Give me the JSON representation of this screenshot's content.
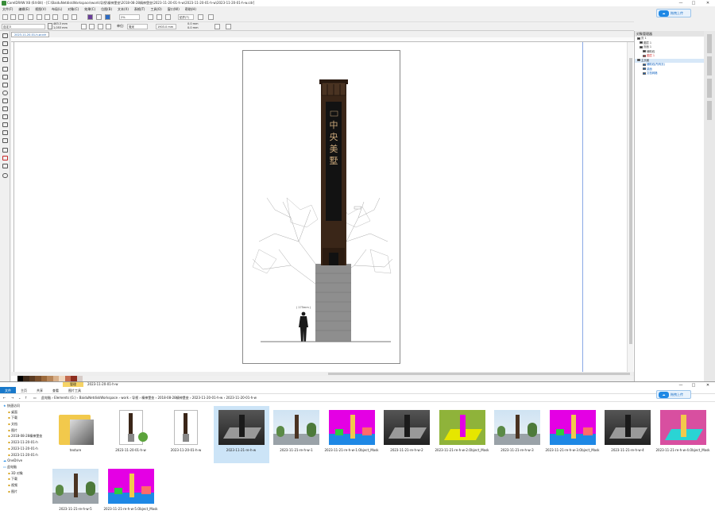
{
  "window": {
    "title": "CorelDRAW X8 (64-Bit) - [C:\\BaiduNetdiskWorkspace\\work\\导视\\精神堡垒\\2018-08-28精神堡垒\\2023-11-20-01-h-w\\2023-11-20-01-h-w\\2023-11-20-01-h-w.cdr]",
    "minimize": "—",
    "maximize": "□",
    "close": "✕"
  },
  "menu": [
    "文件(F)",
    "编辑(E)",
    "视图(V)",
    "布局(L)",
    "对象(C)",
    "效果(C)",
    "位图(B)",
    "文本(X)",
    "表格(T)",
    "工具(O)",
    "窗口(W)",
    "帮助(H)"
  ],
  "toolbar": {
    "zoom": "2%",
    "snap": "贴齐(T)",
    "preset": "自定义",
    "width": "463.3 mm",
    "height": "1,053 mm",
    "unit_label": "单位:",
    "unit": "毫米",
    "nudge": "1903.0 mm",
    "dup_x": "0.0 mm",
    "dup_y": "0.0 mm",
    "upload_label": "拖拽上传"
  },
  "document_tab": "2023-11-20-01-h-w.cdr",
  "artwork": {
    "tower_text": [
      "中",
      "央",
      "美",
      "墅"
    ],
    "height_note": "( 175mm )"
  },
  "object_manager": {
    "title": "对象管理器",
    "rows": [
      {
        "text": "页 1",
        "color": "#333333"
      },
      {
        "text": "图层 1",
        "color": "#333333"
      },
      {
        "text": "页面 1",
        "color": "#333333"
      },
      {
        "text": "辅助线",
        "color": "#333333"
      },
      {
        "text": "图层 1",
        "color": "#d32f2f"
      },
      {
        "text": "主页面",
        "color": "#333333"
      },
      {
        "text": "辅助线(所有页)",
        "color": "#1565c0"
      },
      {
        "text": "桌面",
        "color": "#1565c0"
      },
      {
        "text": "文档网格",
        "color": "#1565c0"
      }
    ]
  },
  "palette": [
    "#ffffff",
    "#000000",
    "#3e2a1a",
    "#5a3b22",
    "#7a4f2c",
    "#9c6a3c",
    "#b8875a",
    "#d8b08a",
    "#f0d9c0",
    "#c46b4f",
    "#8d2d1f",
    "#d7ccc8"
  ],
  "explorer": {
    "manage": "管理",
    "title": "2023-11-20-01-h-w",
    "ribbon": [
      "文件",
      "主页",
      "共享",
      "查看",
      "图片工具"
    ],
    "path": [
      "此电脑",
      "Elements (G:)",
      "BaiduNetdiskWorkspace",
      "work",
      "导视",
      "精神堡垒",
      "2018-08-28精神堡垒",
      "2023-11-20-01-h-w",
      "2023-11-20-01-h-w"
    ],
    "sidebar": [
      "快速访问",
      "桌面",
      "下载",
      "文档",
      "图片",
      "2018-08-28精神堡垒",
      "2023-11-20-01-h",
      "2023-11-20-01-h",
      "2023-11-20-01-h",
      "OneDrive",
      "此电脑",
      "3D 对象",
      "下载",
      "视频",
      "图片"
    ],
    "files": [
      {
        "name": "texture",
        "kind": "folder"
      },
      {
        "name": "2023-11-20-01-h-w",
        "kind": "tower"
      },
      {
        "name": "2023-11-20-01-h-w",
        "kind": "tower2"
      },
      {
        "name": "2023-11-21-re-h-w",
        "kind": "render-dark"
      },
      {
        "name": "2023-11-21-re-h-w-1",
        "kind": "render-street"
      },
      {
        "name": "2023-11-21-re-h-w-1.Object_Mask",
        "kind": "mask"
      },
      {
        "name": "2023-11-21-re-h-w-2",
        "kind": "render-dark"
      },
      {
        "name": "2023-11-21-re-h-w-2.Object_Mask",
        "kind": "mask-green"
      },
      {
        "name": "2023-11-21-re-h-w-3",
        "kind": "render-street"
      },
      {
        "name": "2023-11-21-re-h-w-3.Object_Mask",
        "kind": "mask"
      },
      {
        "name": "2023-11-21-re-h-w-4",
        "kind": "render-dark"
      },
      {
        "name": "2023-11-21-re-h-w-4.Object_Mask",
        "kind": "mask-pink"
      },
      {
        "name": "2023-11-21-re-h-w-5",
        "kind": "render-street"
      },
      {
        "name": "2023-11-21-re-h-w-5.Object_Mask",
        "kind": "mask"
      }
    ]
  }
}
